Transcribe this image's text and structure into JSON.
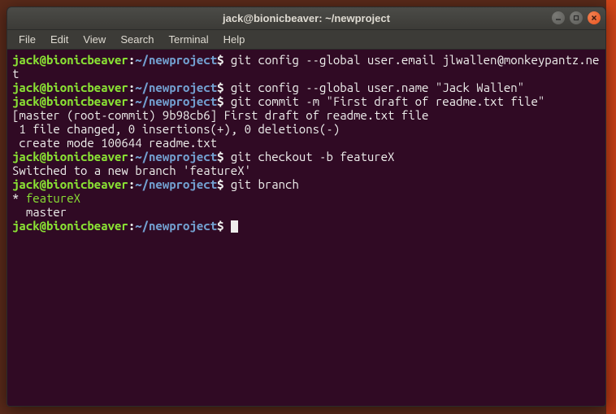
{
  "titlebar": {
    "title": "jack@bionicbeaver: ~/newproject"
  },
  "menubar": {
    "items": [
      "File",
      "Edit",
      "View",
      "Search",
      "Terminal",
      "Help"
    ]
  },
  "prompt": {
    "user_host": "jack@bionicbeaver",
    "separator": ":",
    "path": "~/newproject",
    "symbol": "$"
  },
  "lines": [
    {
      "type": "cmd",
      "text": " git config --global user.email jlwallen@monkeypantz.net"
    },
    {
      "type": "cmd",
      "text": " git config --global user.name \"Jack Wallen\""
    },
    {
      "type": "cmd",
      "text": " git commit -m \"First draft of readme.txt file\""
    },
    {
      "type": "out",
      "text": "[master (root-commit) 9b98cb6] First draft of readme.txt file"
    },
    {
      "type": "out",
      "text": " 1 file changed, 0 insertions(+), 0 deletions(-)"
    },
    {
      "type": "out",
      "text": " create mode 100644 readme.txt"
    },
    {
      "type": "cmd",
      "text": " git checkout -b featureX"
    },
    {
      "type": "out",
      "text": "Switched to a new branch 'featureX'"
    },
    {
      "type": "cmd",
      "text": " git branch"
    },
    {
      "type": "branch",
      "prefix": "* ",
      "text": "featureX"
    },
    {
      "type": "out",
      "text": "  master"
    },
    {
      "type": "cmd",
      "text": " ",
      "cursor": true
    }
  ]
}
